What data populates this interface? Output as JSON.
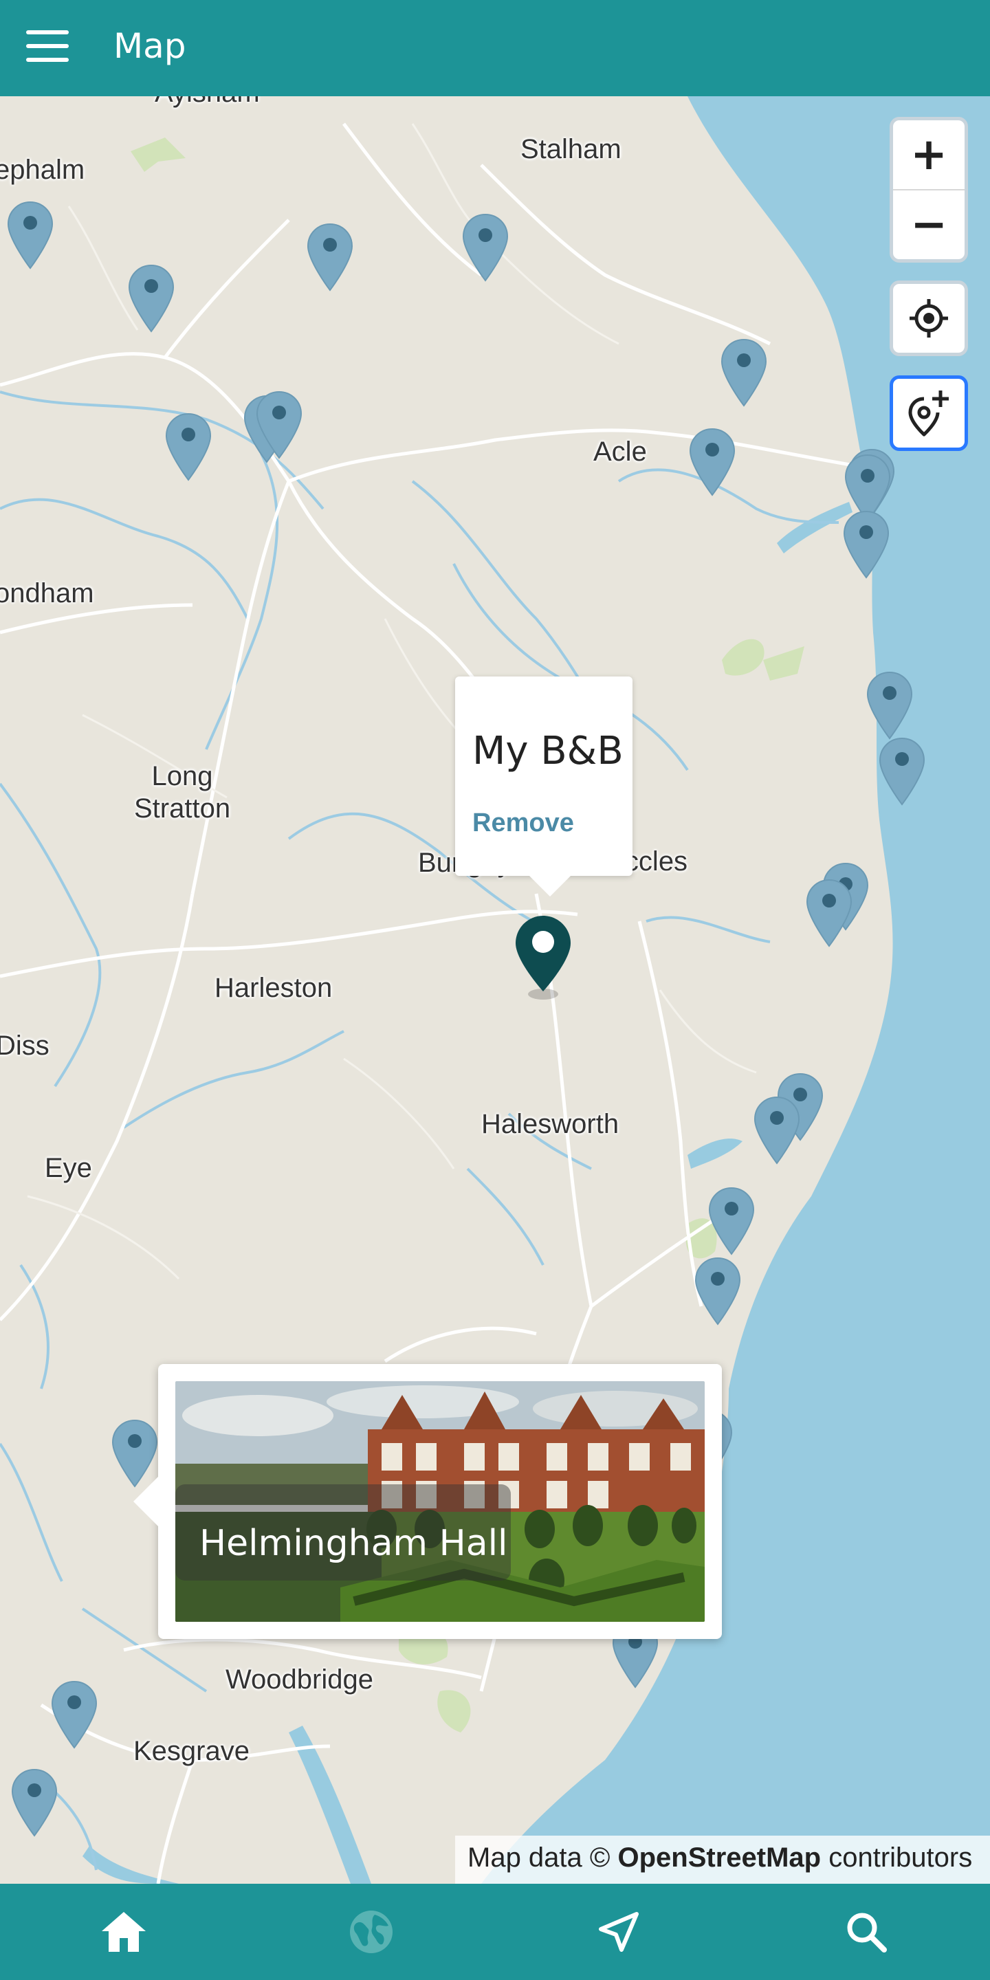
{
  "header": {
    "title": "Map",
    "menu_icon": "hamburger-menu-icon"
  },
  "map": {
    "places": [
      "Aylsham",
      "ephalm",
      "Stalham",
      "Acle",
      "ondham",
      "Long\nStratton",
      "Bungay",
      "Beccles",
      "Harleston",
      "Diss",
      "Halesworth",
      "Eye",
      "Woodbridge",
      "Kesgrave"
    ],
    "controls": {
      "zoom_in": "+",
      "zoom_out": "−",
      "locate_icon": "crosshair-icon",
      "add_place_icon": "add-location-pin-icon"
    },
    "selected_marker_icon": "location-pin-icon"
  },
  "popup": {
    "title": "My B&B",
    "remove_label": "Remove"
  },
  "card": {
    "title": "Helmingham Hall"
  },
  "attribution": {
    "prefix": "Map data © ",
    "source": "OpenStreetMap",
    "suffix": " contributors"
  },
  "nav": [
    {
      "name": "home",
      "icon": "home-icon",
      "active": true
    },
    {
      "name": "explore",
      "icon": "globe-icon",
      "active": false
    },
    {
      "name": "directions",
      "icon": "navigation-arrow-icon",
      "active": true
    },
    {
      "name": "search",
      "icon": "search-icon",
      "active": true
    }
  ],
  "colors": {
    "bar": "#1d9497",
    "sea": "#98cbe0",
    "land": "#e8e5dc",
    "pin": "#7aa9c3",
    "pin_dot": "#35647c",
    "selected_pin": "#0e4c50",
    "link": "#4b8aa6"
  }
}
